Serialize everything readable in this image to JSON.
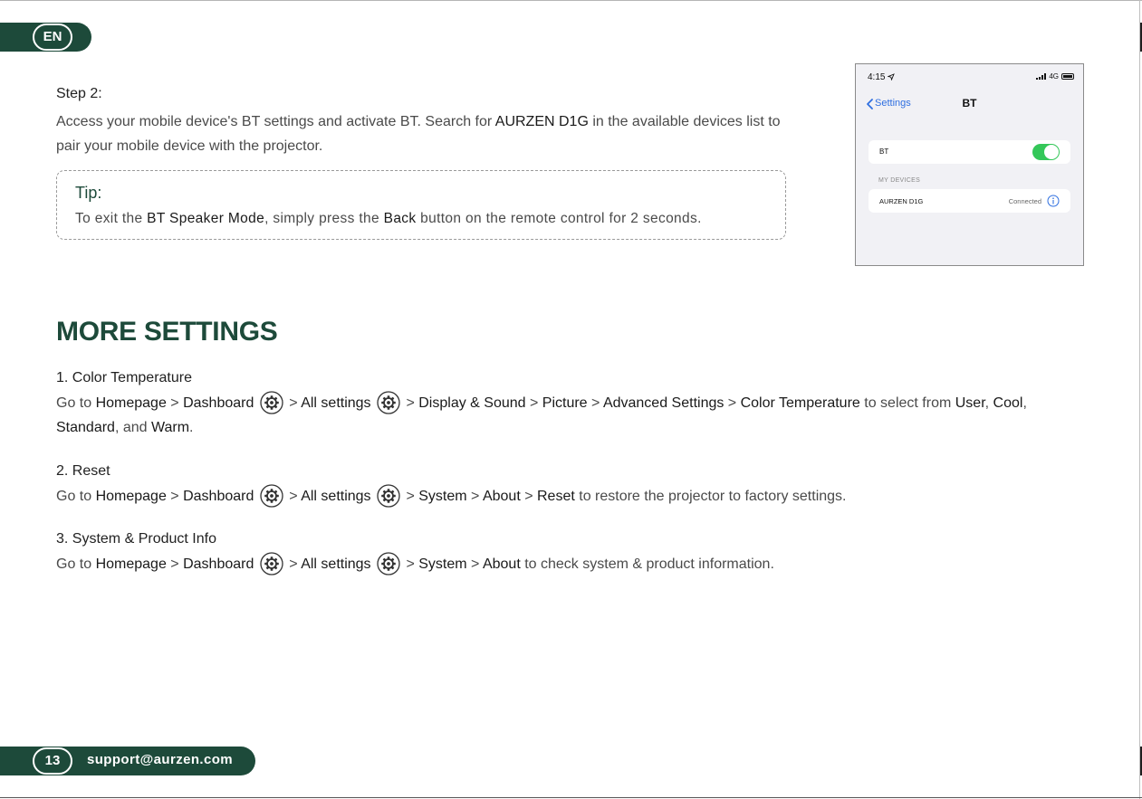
{
  "header": {
    "language_label": "EN"
  },
  "step2": {
    "heading": "Step 2:",
    "body": [
      {
        "t": "Access your mobile device's BT settings and activate BT. Search for "
      },
      {
        "t": "AURZEN D1G",
        "b": true
      },
      {
        "t": " in the available devices list to pair your mobile device with the projector."
      }
    ]
  },
  "tip": {
    "title": "Tip:",
    "body": [
      {
        "t": "To exit the "
      },
      {
        "t": "BT Speaker Mode",
        "b": true
      },
      {
        "t": ", simply press the "
      },
      {
        "t": "Back",
        "b": true
      },
      {
        "t": " button on the remote control for 2 seconds."
      }
    ]
  },
  "phone": {
    "time": "4:15",
    "network": "4G",
    "back_label": "Settings",
    "title": "BT",
    "bt_label": "BT",
    "bt_enabled": true,
    "section_header": "MY DEVICES",
    "device_name": "AURZEN D1G",
    "device_status": "Connected",
    "accent_color": "#2f6fe0",
    "toggle_color": "#34c759"
  },
  "more_settings": {
    "title": "MORE SETTINGS",
    "items": [
      {
        "heading": "1. Color Temperature",
        "body": [
          {
            "t": "Go to "
          },
          {
            "t": "Homepage",
            "b": true
          },
          {
            "t": " > "
          },
          {
            "t": "Dashboard",
            "b": true
          },
          {
            "t": " "
          },
          {
            "icon": "gear-icon"
          },
          {
            "t": " > "
          },
          {
            "t": "All settings",
            "b": true
          },
          {
            "t": " "
          },
          {
            "icon": "gear-icon"
          },
          {
            "t": " > "
          },
          {
            "t": "Display & Sound",
            "b": true
          },
          {
            "t": " > "
          },
          {
            "t": "Picture",
            "b": true
          },
          {
            "t": " > "
          },
          {
            "t": "Advanced Settings",
            "b": true
          },
          {
            "t": " > "
          },
          {
            "t": "Color Temperature",
            "b": true
          },
          {
            "t": " to select from "
          },
          {
            "t": "User",
            "b": true
          },
          {
            "t": ", "
          },
          {
            "t": "Cool",
            "b": true
          },
          {
            "t": ", "
          },
          {
            "t": "Standard",
            "b": true
          },
          {
            "t": ", and "
          },
          {
            "t": "Warm",
            "b": true
          },
          {
            "t": "."
          }
        ]
      },
      {
        "heading": "2. Reset",
        "body": [
          {
            "t": "Go to "
          },
          {
            "t": "Homepage",
            "b": true
          },
          {
            "t": " > "
          },
          {
            "t": "Dashboard",
            "b": true
          },
          {
            "t": " "
          },
          {
            "icon": "gear-icon"
          },
          {
            "t": " > "
          },
          {
            "t": "All settings",
            "b": true
          },
          {
            "t": " "
          },
          {
            "icon": "gear-icon"
          },
          {
            "t": " > "
          },
          {
            "t": "System",
            "b": true
          },
          {
            "t": " > "
          },
          {
            "t": "About",
            "b": true
          },
          {
            "t": " > "
          },
          {
            "t": "Reset",
            "b": true
          },
          {
            "t": " to restore the projector to factory settings."
          }
        ]
      },
      {
        "heading": "3. System & Product Info",
        "body": [
          {
            "t": "Go to "
          },
          {
            "t": "Homepage",
            "b": true
          },
          {
            "t": " > "
          },
          {
            "t": "Dashboard",
            "b": true
          },
          {
            "t": " "
          },
          {
            "icon": "gear-icon"
          },
          {
            "t": " > "
          },
          {
            "t": "All settings",
            "b": true
          },
          {
            "t": " "
          },
          {
            "icon": "gear-icon"
          },
          {
            "t": " > "
          },
          {
            "t": "System",
            "b": true
          },
          {
            "t": " > "
          },
          {
            "t": "About",
            "b": true
          },
          {
            "t": " to check system & product information."
          }
        ]
      }
    ]
  },
  "footer": {
    "page_number": "13",
    "email": "support@aurzen.com"
  },
  "colors": {
    "brand_green": "#1d4a3a"
  }
}
